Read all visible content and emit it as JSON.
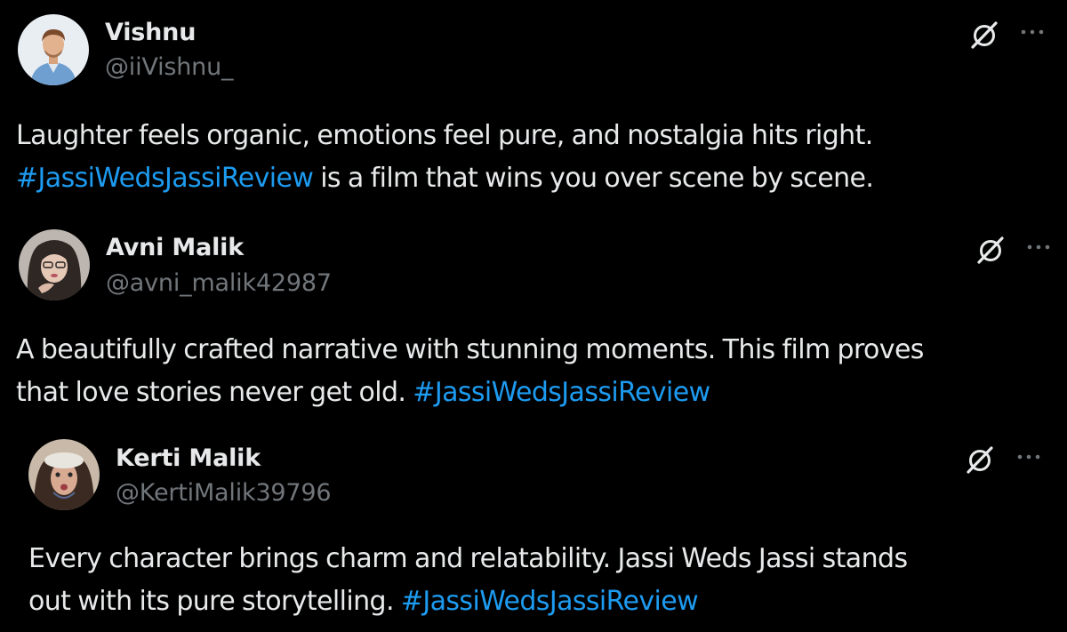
{
  "colors": {
    "background": "#000000",
    "text": "#e7e9ea",
    "muted": "#71767b",
    "link": "#1d9bf0"
  },
  "tweets": [
    {
      "name": "Vishnu",
      "handle": "@iiVishnu_",
      "avatar_icon": "profile-photo-man-blue-shirt",
      "line1": "Laughter feels organic, emotions feel pure, and nostalgia hits right.",
      "line2_hashtag": "#JassiWedsJassiReview",
      "line2_text": " is a film that wins you over scene by scene."
    },
    {
      "name": "Avni Malik",
      "handle": "@avni_malik42987",
      "avatar_icon": "profile-photo-woman",
      "line1": "A beautifully crafted narrative with stunning moments. This film proves",
      "line2_text": "that love stories never get old.  ",
      "line2_hashtag": "#JassiWedsJassiReview"
    },
    {
      "name": "Kerti Malik",
      "handle": "@KertiMalik39796",
      "avatar_icon": "profile-photo-filtered-selfie",
      "line1": "Every character brings charm and relatability. Jassi Weds Jassi stands",
      "line2_text": "out with its pure storytelling.  ",
      "line2_hashtag": "#JassiWedsJassiReview"
    }
  ]
}
